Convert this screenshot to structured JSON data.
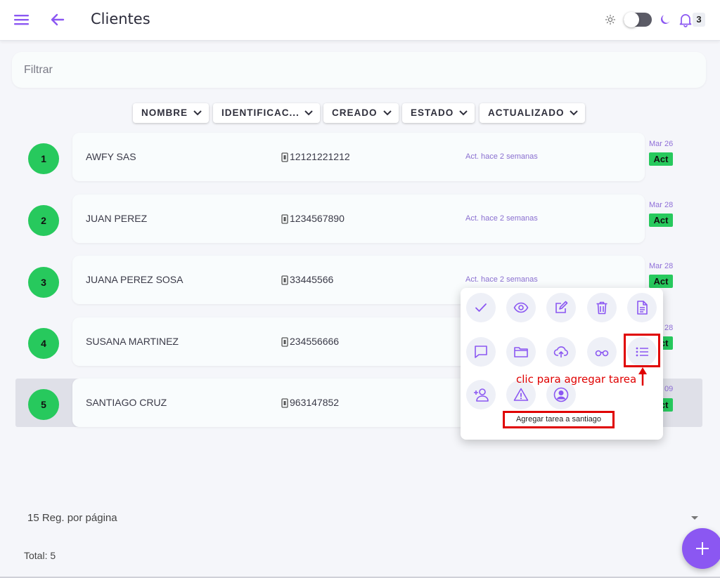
{
  "header": {
    "title": "Clientes",
    "notification_count": "3",
    "accent_color": "#8b57f2"
  },
  "filter": {
    "placeholder": "Filtrar"
  },
  "sort_buttons": [
    "NOMBRE",
    "IDENTIFICAC...",
    "CREADO",
    "ESTADO",
    "ACTUALIZADO"
  ],
  "rows": [
    {
      "num": "1",
      "name": "AWFY SAS",
      "id": "12121221212",
      "updated": "Act. hace 2 semanas",
      "date": "Mar 26",
      "status": "Act"
    },
    {
      "num": "2",
      "name": "JUAN PEREZ",
      "id": "1234567890",
      "updated": "Act. hace 2 semanas",
      "date": "Mar 28",
      "status": "Act"
    },
    {
      "num": "3",
      "name": "JUANA PEREZ SOSA",
      "id": "33445566",
      "updated": "Act. hace 2 semanas",
      "date": "Mar 28",
      "status": "Act"
    },
    {
      "num": "4",
      "name": "SUSANA MARTINEZ",
      "id": "234556666",
      "updated": "",
      "date": "28",
      "status": "Act"
    },
    {
      "num": "5",
      "name": "SANTIAGO CRUZ",
      "id": "963147852",
      "updated": "",
      "date": "09",
      "status": "Act"
    }
  ],
  "popup": {
    "actions_row1": [
      "check-icon",
      "eye-icon",
      "edit-icon",
      "trash-icon",
      "document-icon"
    ],
    "actions_row2": [
      "comment-icon",
      "folder-icon",
      "cloud-upload-icon",
      "glasses-icon",
      "list-icon"
    ],
    "actions_row3": [
      "add-user-icon",
      "warning-icon",
      "user-circle-icon"
    ],
    "tooltip": "Agregar tarea a santiago"
  },
  "annotation": {
    "text": "clic para agregar tarea",
    "color": "#e00000"
  },
  "footer": {
    "per_page": "15 Reg. por página",
    "total": "Total: 5"
  }
}
